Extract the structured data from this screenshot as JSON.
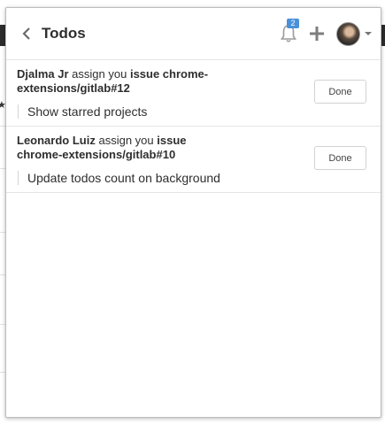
{
  "header": {
    "title": "Todos",
    "notification_count": "2"
  },
  "todos": [
    {
      "author": "Djalma Jr",
      "action": "assign you",
      "target": "issue chrome-extensions/gitlab#12",
      "body": "Show starred projects",
      "done_label": "Done"
    },
    {
      "author": "Leonardo Luiz",
      "action": "assign you",
      "target": "issue chrome-extensions/gitlab#10",
      "body": "Update todos count on background",
      "done_label": "Done"
    }
  ],
  "colors": {
    "badge": "#4a90d9",
    "border": "#e5e5e5",
    "text": "#2e2e2e"
  }
}
